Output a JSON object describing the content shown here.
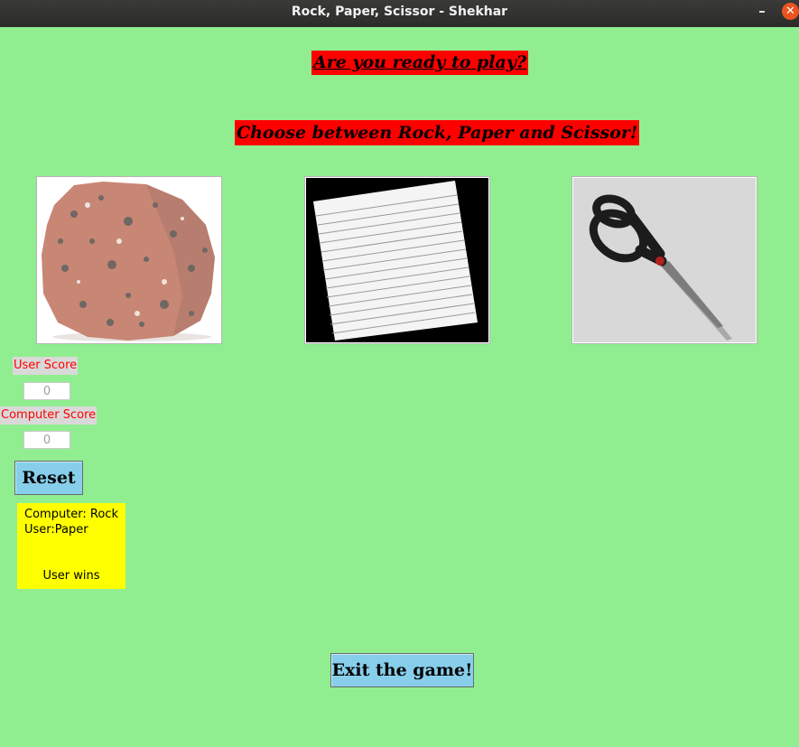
{
  "window": {
    "title": "Rock, Paper, Scissor - Shekhar",
    "minimize_symbol": "–",
    "close_symbol": "✕"
  },
  "banners": {
    "ready": "Are you ready to play?",
    "choose": "Choose between Rock, Paper and Scissor!"
  },
  "choices": [
    {
      "name": "rock",
      "image": "rock-image"
    },
    {
      "name": "paper",
      "image": "paper-image"
    },
    {
      "name": "scissor",
      "image": "scissor-image"
    }
  ],
  "scores": {
    "user_label": "User Score",
    "user_value": "0",
    "computer_label": "Computer Score",
    "computer_value": "0"
  },
  "buttons": {
    "reset": "Reset",
    "exit": "Exit the game!"
  },
  "result": {
    "computer": "Computer: Rock",
    "user": "User:Paper",
    "outcome": "User wins"
  },
  "colors": {
    "background": "#90ee90",
    "banner": "#ff0000",
    "button": "#87ceeb",
    "result_box": "#ffff00",
    "score_label_text": "#ff0000"
  }
}
